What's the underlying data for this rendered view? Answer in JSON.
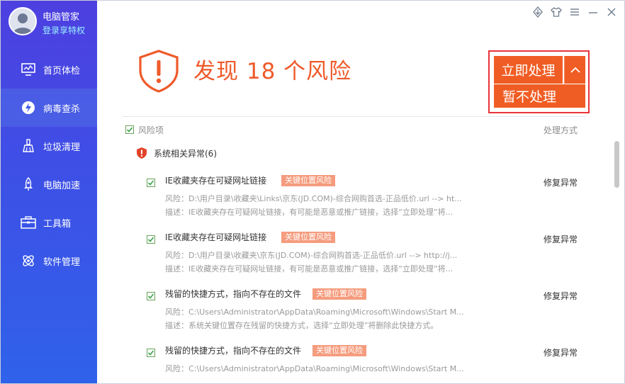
{
  "profile": {
    "app_name": "电脑管家",
    "login_link": "登录享特权"
  },
  "nav": [
    {
      "label": "首页体检",
      "icon": "monitor-icon",
      "active": false
    },
    {
      "label": "病毒查杀",
      "icon": "virus-scan-icon",
      "active": true
    },
    {
      "label": "垃圾清理",
      "icon": "broom-icon",
      "active": false
    },
    {
      "label": "电脑加速",
      "icon": "rocket-icon",
      "active": false
    },
    {
      "label": "工具箱",
      "icon": "toolbox-icon",
      "active": false
    },
    {
      "label": "软件管理",
      "icon": "software-icon",
      "active": false
    }
  ],
  "titlebar": [
    "shield-leaf-icon",
    "tshirt-skin-icon",
    "menu-icon",
    "minimize-icon",
    "close-icon"
  ],
  "header": {
    "title": "发现 18 个风险"
  },
  "actions": {
    "primary": "立即处理",
    "secondary": "暂不处理"
  },
  "list": {
    "col_name": "风险项",
    "col_action": "处理方式",
    "group": "系统相关异常(6)",
    "items": [
      {
        "title": "IE收藏夹存在可疑网址链接",
        "tag": "关键位置风险",
        "line1": "风险：D:\\用户目录\\收藏夹\\Links\\京东(JD.COM)-综合网购首选-正品低价.url --> ht...",
        "line2": "描述：IE收藏夹存在可疑网址链接，有可能是恶意或推广链接，选择“立即处理”将...",
        "action": "修复异常"
      },
      {
        "title": "IE收藏夹存在可疑网址链接",
        "tag": "关键位置风险",
        "line1": "风险：D:\\用户目录\\收藏夹\\京东(JD.COM)-综合网购首选-正品低价.url --> http://j...",
        "line2": "描述：IE收藏夹存在可疑网址链接，有可能是恶意或推广链接，选择“立即处理”将...",
        "action": "修复异常"
      },
      {
        "title": "残留的快捷方式，指向不存在的文件",
        "tag": "关键位置风险",
        "line1": "风险：C:\\Users\\Administrator\\AppData\\Roaming\\Microsoft\\Windows\\Start M...",
        "line2": "描述：系统关键位置存在残留的快捷方式，选择“立即处理”将删除此快捷方式。",
        "action": "修复异常"
      },
      {
        "title": "残留的快捷方式，指向不存在的文件",
        "tag": "关键位置风险",
        "line1": "风险：C:\\Users\\Administrator\\AppData\\Roaming\\Microsoft\\Windows\\Start M...",
        "line2": "",
        "action": "修复异常"
      }
    ]
  },
  "colors": {
    "accent": "#f05d24",
    "highlight_border": "#e8343a",
    "tag": "#f59c7e",
    "sidebar_top": "#4d3fe0",
    "sidebar_bottom": "#2f62ea",
    "check": "#3aa34a"
  }
}
